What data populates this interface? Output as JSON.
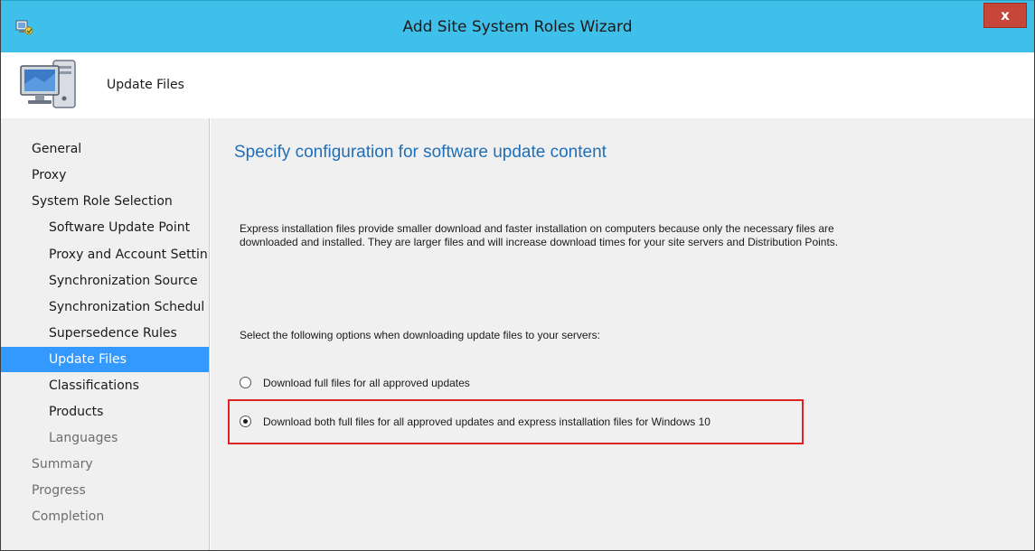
{
  "window": {
    "title": "Add Site System Roles Wizard",
    "close_label": "x",
    "app_icon": "wizard-app-icon"
  },
  "header": {
    "title": "Update Files",
    "icon": "computer-monitor-icon"
  },
  "sidebar": {
    "items": [
      {
        "label": "General"
      },
      {
        "label": "Proxy"
      },
      {
        "label": "System Role Selection"
      },
      {
        "label": "Software Update Point"
      },
      {
        "label": "Proxy and Account Settin"
      },
      {
        "label": "Synchronization Source"
      },
      {
        "label": "Synchronization Schedul"
      },
      {
        "label": "Supersedence Rules"
      },
      {
        "label": "Update Files"
      },
      {
        "label": "Classifications"
      },
      {
        "label": "Products"
      },
      {
        "label": "Languages"
      },
      {
        "label": "Summary"
      },
      {
        "label": "Progress"
      },
      {
        "label": "Completion"
      }
    ],
    "selected": "Update Files"
  },
  "main": {
    "heading": "Specify configuration for software update content",
    "description_line1": "Express installation files provide smaller download and faster installation on computers because only the necessary files are",
    "description_line2": "downloaded and installed.  They are larger files and will increase download times for your site servers and Distribution Points.",
    "prompt": "Select the following options when downloading update files to your servers:",
    "options": [
      {
        "label": "Download full files for all approved updates",
        "checked": false
      },
      {
        "label": "Download both full files for all approved updates and express installation files for Windows 10",
        "checked": true
      }
    ]
  },
  "colors": {
    "titlebar": "#3fc0ea",
    "close_button": "#c7463a",
    "selected_item": "#3399ff",
    "heading": "#1f6fb8",
    "highlight_border": "#e02424"
  }
}
